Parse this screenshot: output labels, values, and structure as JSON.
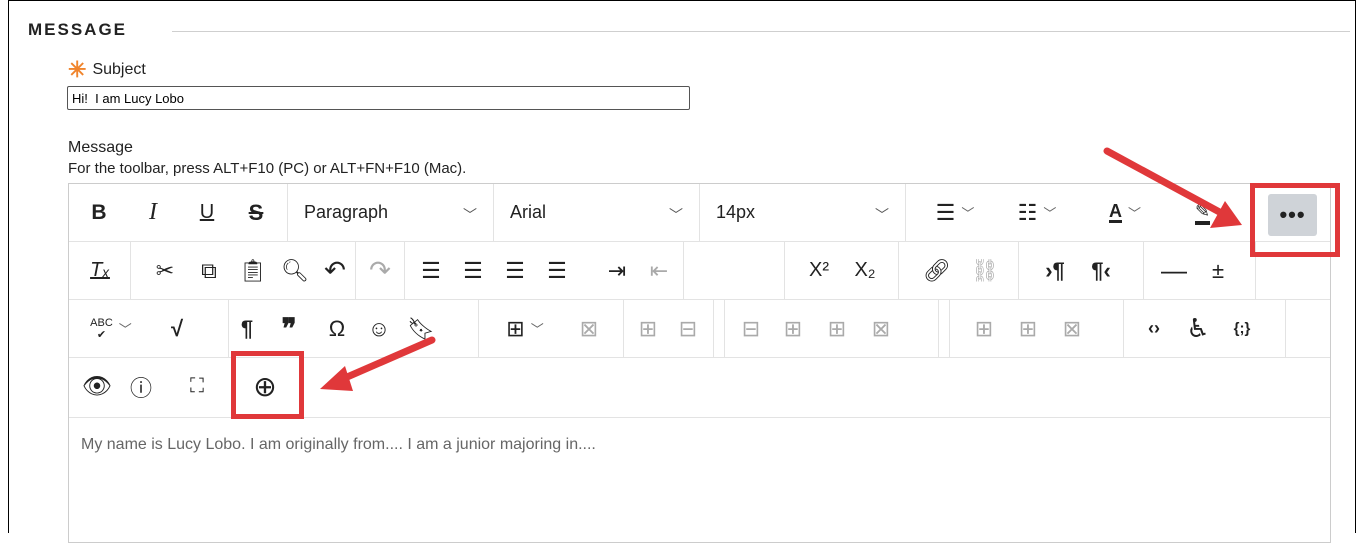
{
  "section": {
    "title": "MESSAGE"
  },
  "subject": {
    "label": "Subject",
    "value": "Hi!  I am Lucy Lobo"
  },
  "message": {
    "label": "Message",
    "help": "For the toolbar, press ALT+F10 (PC) or ALT+FN+F10 (Mac).",
    "body": "My name is Lucy Lobo.   I am originally from....  I am a junior majoring in...."
  },
  "toolbar": {
    "format": "Paragraph",
    "font": "Arial",
    "size": "14px",
    "bold": "B",
    "italic": "I",
    "underline": "U",
    "strike": "S",
    "superscript": "X²",
    "subscript": "X₂",
    "more": "•••",
    "spellcheck": "ABC"
  },
  "colors": {
    "accent": "#e0383a",
    "required": "#f0842c",
    "more_bg": "#cfd3d8"
  }
}
